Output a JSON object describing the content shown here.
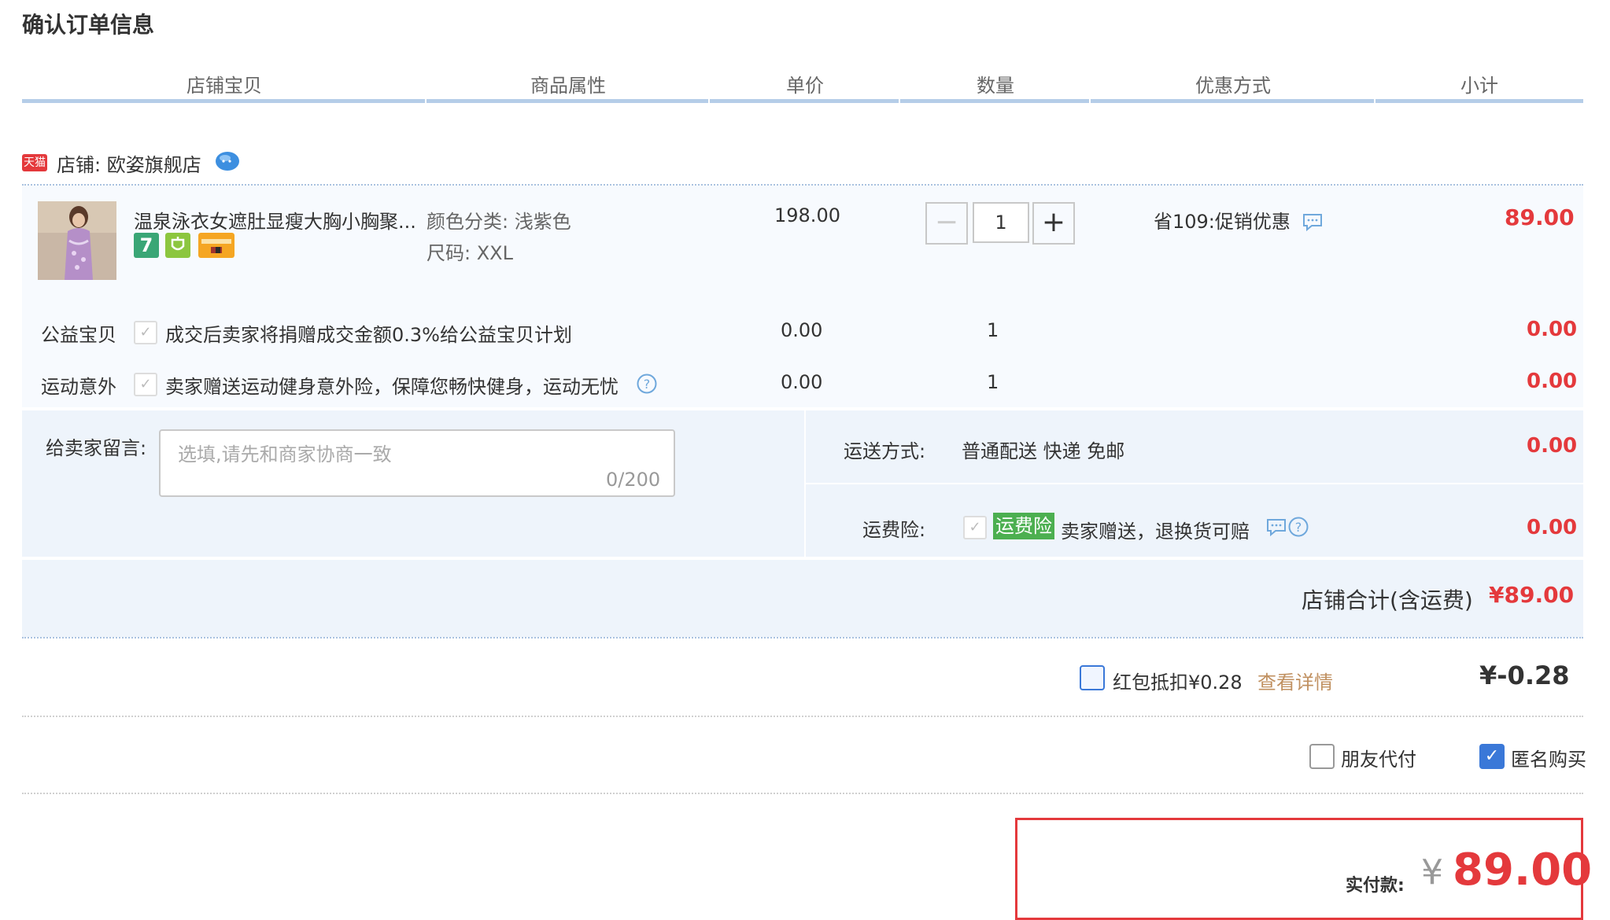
{
  "page_title": "确认订单信息",
  "columns": [
    "店铺宝贝",
    "商品属性",
    "单价",
    "数量",
    "优惠方式",
    "小计"
  ],
  "shop": {
    "badge": "天猫",
    "label": "店铺: 欧姿旗舰店"
  },
  "item": {
    "title": "温泉泳衣女遮肚显瘦大胸小胸聚...",
    "attr_color": "颜色分类: 浅紫色",
    "attr_size": "尺码: XXL",
    "price": "198.00",
    "quantity": "1",
    "promo": "省109:促销优惠",
    "subtotal": "89.00",
    "badges": [
      "7-days-return-icon",
      "guarantee-icon",
      "credit-card-icon"
    ]
  },
  "addons": [
    {
      "name": "公益宝贝",
      "desc": "成交后卖家将捐赠成交金额0.3%给公益宝贝计划",
      "price": "0.00",
      "qty": "1",
      "subtotal": "0.00"
    },
    {
      "name": "运动意外",
      "desc": "卖家赠送运动健身意外险，保障您畅快健身，运动无忧",
      "price": "0.00",
      "qty": "1",
      "subtotal": "0.00"
    }
  ],
  "message": {
    "label": "给卖家留言:",
    "placeholder": "选填,请先和商家协商一致",
    "counter": "0/200"
  },
  "shipping": {
    "label": "运送方式:",
    "method": "普通配送 快递 免邮",
    "fee": "0.00"
  },
  "insurance": {
    "label": "运费险:",
    "tag": "运费险",
    "desc": "卖家赠送，退换货可赔",
    "fee": "0.00"
  },
  "shop_total": {
    "label": "店铺合计(含运费)",
    "value": "¥89.00"
  },
  "redpacket": {
    "label": "红包抵扣¥0.28",
    "link": "查看详情",
    "value": "¥-0.28"
  },
  "options": {
    "friend_pay": "朋友代付",
    "anonymous": "匿名购买",
    "anonymous_checked": true,
    "friend_pay_checked": false
  },
  "payment": {
    "label": "实付款:",
    "currency": "¥",
    "amount": "89.00"
  },
  "colors": {
    "accent_red": "#e4393c",
    "header_bar": "#b5cde8",
    "checkbox_blue": "#3a78d8",
    "link_brown": "#c09060"
  }
}
